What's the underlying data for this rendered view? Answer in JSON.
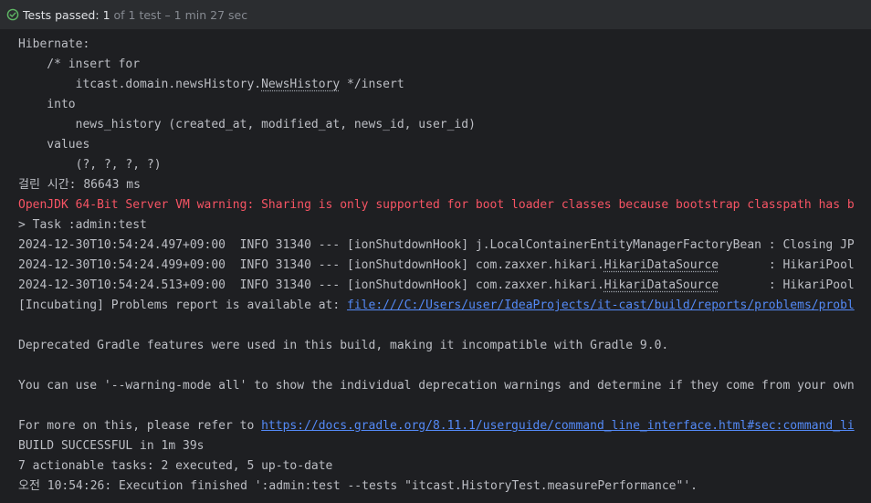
{
  "status": {
    "icon": "check-circle-icon",
    "label": "Tests passed:",
    "count": "1",
    "rest": "of 1 test – 1 min 27 sec",
    "colors": {
      "success": "#5fb865",
      "muted": "#868a91"
    }
  },
  "console": {
    "partial_top": "· · ·",
    "hibernate": "Hibernate:",
    "insert_comment_pre": "    /* insert for",
    "entity_pkg": "        itcast.domain.newsHistory.",
    "entity_class": "NewsHistory",
    "entity_post": " */insert",
    "into": "    into",
    "table_cols": "        news_history (created_at, modified_at, news_id, user_id)",
    "values_kw": "    values",
    "values_params": "        (?, ?, ?, ?)",
    "elapsed": "걸린 시간: 86643 ms",
    "jvm_warning": "OpenJDK 64-Bit Server VM warning: Sharing is only supported for boot loader classes because bootstrap classpath has b",
    "task": "> Task :admin:test",
    "log1": "2024-12-30T10:54:24.497+09:00  INFO 31340 --- [ionShutdownHook] j.LocalContainerEntityManagerFactoryBean : Closing JP",
    "log2_pre": "2024-12-30T10:54:24.499+09:00  INFO 31340 --- [ionShutdownHook] com.zaxxer.hikari.",
    "log2_cls": "HikariDataSource",
    "log2_post": "       : HikariPool",
    "log3_pre": "2024-12-30T10:54:24.513+09:00  INFO 31340 --- [ionShutdownHook] com.zaxxer.hikari.",
    "log3_cls": "HikariDataSource",
    "log3_post": "       : HikariPool",
    "problems_pre": "[Incubating] Problems report is available at: ",
    "problems_link": "file:///C:/Users/user/IdeaProjects/it-cast/build/reports/problems/probl",
    "deprecated": "Deprecated Gradle features were used in this build, making it incompatible with Gradle 9.0.",
    "warning_mode": "You can use '--warning-mode all' to show the individual deprecation warnings and determine if they come from your own",
    "more_info_pre": "For more on this, please refer to ",
    "more_info_link": "https://docs.gradle.org/8.11.1/userguide/command_line_interface.html#sec:command_li",
    "build": "BUILD SUCCESSFUL in 1m 39s",
    "tasks": "7 actionable tasks: 2 executed, 5 up-to-date",
    "finished": "오전 10:54:26: Execution finished ':admin:test --tests \"itcast.HistoryTest.measurePerformance\"'."
  }
}
